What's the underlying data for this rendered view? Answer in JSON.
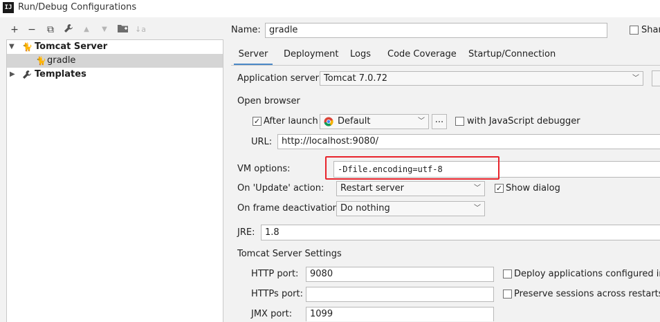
{
  "window": {
    "title": "Run/Debug Configurations",
    "app_icon_text": "IJ"
  },
  "toolbar": {
    "add": "+",
    "remove": "−",
    "copy": "⧉",
    "edit": "🔧",
    "move_up": "▲",
    "move_down": "▼",
    "folder": "📁",
    "sort": "↓a"
  },
  "tree": {
    "tomcat_server": "Tomcat Server",
    "gradle": "gradle",
    "templates": "Templates"
  },
  "name_field": {
    "label": "Name:",
    "value": "gradle",
    "share_label": "Share"
  },
  "tabs": [
    {
      "label": "Server"
    },
    {
      "label": "Deployment"
    },
    {
      "label": "Logs"
    },
    {
      "label": "Code Coverage"
    },
    {
      "label": "Startup/Connection"
    }
  ],
  "server": {
    "app_server_label": "Application server:",
    "app_server_value": "Tomcat 7.0.72",
    "open_browser_label": "Open browser",
    "after_launch_label": "After launch",
    "after_launch_checked": "✓",
    "browser_value": "Default",
    "browse_btn": "...",
    "js_debugger_label": "with JavaScript debugger",
    "url_label": "URL:",
    "url_value": "http://localhost:9080/",
    "vm_options_label": "VM options:",
    "vm_options_value": "-Dfile.encoding=utf-8",
    "highlight_color": "#e8232b",
    "on_update_label": "On 'Update' action:",
    "on_update_value": "Restart server",
    "show_dialog_label": "Show dialog",
    "show_dialog_checked": "✓",
    "on_frame_label": "On frame deactivation:",
    "on_frame_value": "Do nothing",
    "jre_label": "JRE:",
    "jre_value": "1.8",
    "tomcat_settings_label": "Tomcat Server Settings",
    "http_port_label": "HTTP port:",
    "http_port_value": "9080",
    "deploy_apps_label": "Deploy applications configured in To",
    "https_port_label": "HTTPs port:",
    "https_port_value": "",
    "preserve_sessions_label": "Preserve sessions across restarts an",
    "jmx_port_label": "JMX port:",
    "jmx_port_value": "1099"
  }
}
